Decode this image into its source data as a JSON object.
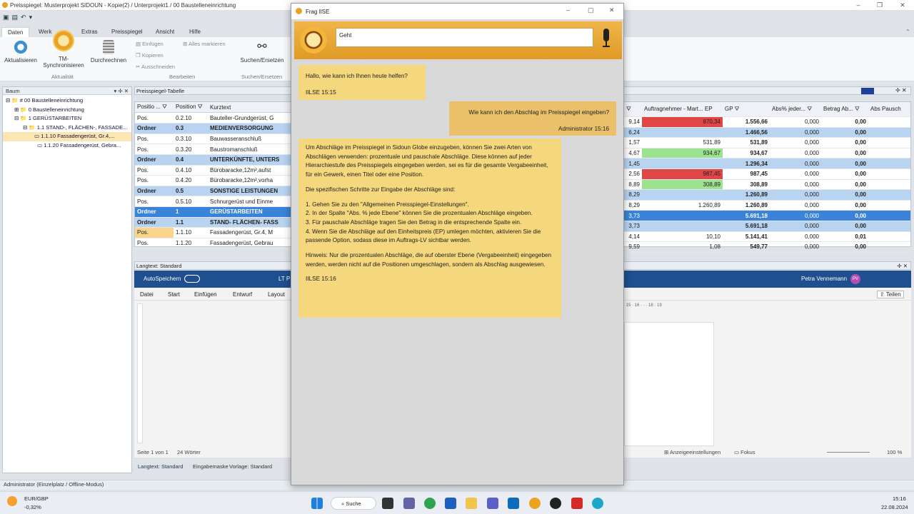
{
  "app": {
    "title": "Preisspiegel: Musterprojekt SIDOUN - Kopie(2) / Unterprojekt1 / 00 Baustelleneinrichtung",
    "tabs": [
      "Daten",
      "Werk",
      "Extras",
      "Preisspiegel",
      "Ansicht",
      "Hilfe"
    ],
    "ribbon": {
      "aktualisieren": "Aktualisieren",
      "tm1": "TM-",
      "tm2": "Synchronisieren",
      "grp_aktualitaet": "Aktualität",
      "durchrechnen": "Durchrechnen",
      "einfuegen": "Einfügen",
      "kopieren": "Kopieren",
      "ausschneiden": "Ausschneiden",
      "alles_markieren": "Alles markieren",
      "grp_bearbeiten": "Bearbeiten",
      "suchen": "Suchen/Ersetzen",
      "grp_suchen": "Suchen/Ersetzen"
    }
  },
  "tree": {
    "title": "Baum",
    "items": [
      "# 00 Baustelleneinrichtung",
      "0 Baustelleneinrichtung",
      "1 GERÜSTARBEITEN",
      "1.1 STAND-, FLÄCHEN-, FASSADE...",
      "1.1.10 Fassadengerüst, Gr.4,...",
      "1.1.20 Fassadengerüst, Gebra..."
    ]
  },
  "grid": {
    "title": "Preisspiegel-Tabelle",
    "headers": [
      "Positio ...",
      "Position",
      "Kurztext"
    ],
    "rows": [
      [
        "Pos.",
        "0.2.10",
        "Bauteller-Grundgerüst, G"
      ],
      [
        "Ordner",
        "0.3",
        "MEDIENVERSORGUNG"
      ],
      [
        "Pos.",
        "0.3.10",
        "Bauwasseranschluß"
      ],
      [
        "Pos.",
        "0.3.20",
        "Baustromanschluß"
      ],
      [
        "Ordner",
        "0.4",
        "UNTERKÜNFTE, UNTERS"
      ],
      [
        "Pos.",
        "0.4.10",
        "Bürobaracke,12m²,aufst"
      ],
      [
        "Pos.",
        "0.4.20",
        "Bürobaracke,12m²,vorha"
      ],
      [
        "Ordner",
        "0.5",
        "SONSTIGE LEISTUNGEN"
      ],
      [
        "Pos.",
        "0.5.10",
        "Schnurgerüst und Einme"
      ],
      [
        "Ordner",
        "1",
        "GERÜSTARBEITEN"
      ],
      [
        "Ordner",
        "1.1",
        "STAND- FLÄCHEN- FASS"
      ],
      [
        "Pos.",
        "1.1.10",
        "Fassadengerüst, Gr.4, M"
      ],
      [
        "Pos.",
        "1.1.20",
        "Fassadengerüst, Gebrau"
      ]
    ]
  },
  "rgrid": {
    "headers": [
      "",
      "Auftragnehmer - Mart... EP",
      "GP",
      "Abs% jeder...",
      "Betrag Ab...",
      "Abs Pausch"
    ],
    "rows": [
      [
        "9,14",
        "870,34",
        "1.556,66",
        "0,000",
        "0,00"
      ],
      [
        "6,24",
        "",
        "1.466,56",
        "0,000",
        "0,00"
      ],
      [
        "1,57",
        "531,89",
        "531,89",
        "0,000",
        "0,00"
      ],
      [
        "4,67",
        "934,67",
        "934,67",
        "0,000",
        "0,00"
      ],
      [
        "1,45",
        "",
        "1.296,34",
        "0,000",
        "0,00"
      ],
      [
        "2,56",
        "987,45",
        "987,45",
        "0,000",
        "0,00"
      ],
      [
        "8,89",
        "308,89",
        "308,89",
        "0,000",
        "0,00"
      ],
      [
        "8,29",
        "",
        "1.260,89",
        "0,000",
        "0,00"
      ],
      [
        "8,29",
        "1.260,89",
        "1.260,89",
        "0,000",
        "0,00"
      ],
      [
        "3,73",
        "",
        "5.691,18",
        "0,000",
        "0,00"
      ],
      [
        "3,73",
        "",
        "5.691,18",
        "0,000",
        "0,00"
      ],
      [
        "4,14",
        "10,10",
        "5.141,41",
        "0,000",
        "0,01"
      ],
      [
        "9,59",
        "1,08",
        "549,77",
        "0,000",
        "0,00"
      ]
    ]
  },
  "word": {
    "panel_title": "Langtext: Standard",
    "autosave": "AutoSpeichern",
    "doc": "LT P",
    "user": "Petra Vennemann",
    "initials": "PV",
    "menu": [
      "Datei",
      "Start",
      "Einfügen",
      "Entwurf",
      "Layout"
    ],
    "share": "Teilen",
    "page": "Seite 1 von 1",
    "words": "24 Wörter",
    "display": "Anzeigeeinstellungen",
    "focus": "Fokus",
    "zoom": "100 %",
    "tabs": [
      "Langtext: Standard",
      "Eingabemaske",
      "Vorlage: Standard"
    ]
  },
  "chat": {
    "title": "Frag IlSE",
    "input": "Geht",
    "greeting": "Hallo, wie kann ich Ihnen heute helfen?",
    "greeting_time": "IILSE 15:15",
    "question": "Wie kann ich den Abschlag im Preisspiegel eingeben?",
    "question_time": "Administrator 15:16",
    "answer": [
      "Um Abschläge im Preisspiegel in Sidoun Globe einzugeben, können Sie zwei Arten von Abschlägen verwenden: prozentuale und pauschale Abschläge. Diese können auf jeder Hierarchiestufe des Preisspiegels eingegeben werden, sei es für die gesamte Vergabeeinheit, für ein Gewerk, einen Titel oder eine Position.",
      "Die spezifischen Schritte zur Eingabe der Abschläge sind:",
      "1. Gehen Sie zu den \"Allgemeinen Preisspiegel-Einstellungen\".",
      "2. In der Spalte \"Abs. % jede Ebene\" können Sie die prozentualen Abschläge eingeben.",
      "3. Für pauschale Abschläge tragen Sie den Betrag in die entsprechende Spalte ein.",
      "4. Wenn Sie die Abschläge auf den Einheitspreis (EP) umlegen möchten, aktivieren Sie die passende Option, sodass diese im Auftrags-LV sichtbar werden.",
      "Hinweis: Nur die prozentualen Abschläge, die auf oberster Ebene (Vergabeeinheit) eingegeben werden, werden nicht auf die Positionen umgeschlagen, sondern als Abschlag ausgewiesen."
    ],
    "answer_time": "IILSE 15:16"
  },
  "status": "Administrator (Einzelplatz / Offline-Modus)",
  "taskbar": {
    "ticker": "EUR/GBP",
    "ticker_val": "-0,32%",
    "search": "Suche",
    "time": "15:16",
    "date": "22.08.2024"
  }
}
